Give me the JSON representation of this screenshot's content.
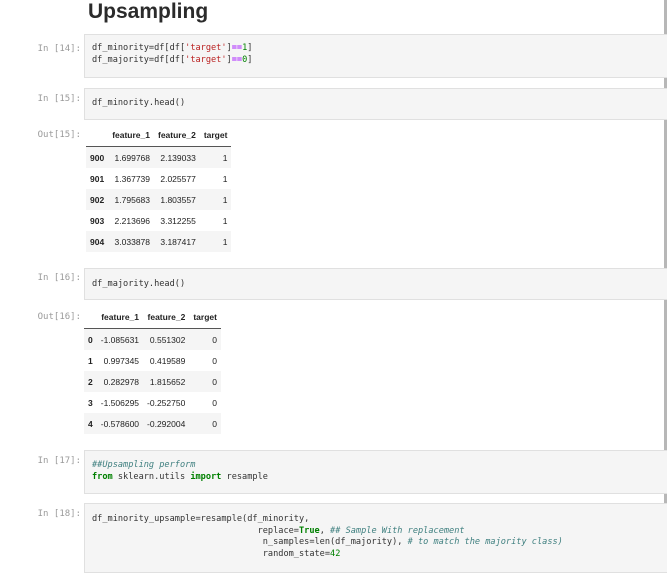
{
  "heading": "Upsampling",
  "cells": {
    "c14": {
      "prompt": "In [14]:",
      "line1": "df_minority=df[df['target']==1]",
      "line2": "df_majority=df[df['target']==0]"
    },
    "c15": {
      "prompt": "In [15]:",
      "code": "df_minority.head()",
      "out_prompt": "Out[15]:"
    },
    "c16": {
      "prompt": "In [16]:",
      "code": "df_majority.head()",
      "out_prompt": "Out[16]:"
    },
    "c17": {
      "prompt": "In [17]:",
      "comment": "##Upsampling perform",
      "from": "from",
      "module": " sklearn.utils ",
      "import": "import",
      "name": " resample"
    },
    "c18": {
      "prompt": "In [18]:",
      "line1": "df_minority_upsample=resample(df_minority,",
      "l2_a": "replace=",
      "l2_true": "True",
      "l2_b": ", ",
      "l2_comment": "## Sample With replacement",
      "l3_a": "n_samples=len(df_majority), ",
      "l3_comment": "# to match the majority class)",
      "l4_a": "random_state=",
      "l4_num": "42"
    }
  },
  "table_minority": {
    "columns": [
      "",
      "feature_1",
      "feature_2",
      "target"
    ],
    "rows": [
      [
        "900",
        "1.699768",
        "2.139033",
        "1"
      ],
      [
        "901",
        "1.367739",
        "2.025577",
        "1"
      ],
      [
        "902",
        "1.795683",
        "1.803557",
        "1"
      ],
      [
        "903",
        "2.213696",
        "3.312255",
        "1"
      ],
      [
        "904",
        "3.033878",
        "3.187417",
        "1"
      ]
    ]
  },
  "table_majority": {
    "columns": [
      "",
      "feature_1",
      "feature_2",
      "target"
    ],
    "rows": [
      [
        "0",
        "-1.085631",
        "0.551302",
        "0"
      ],
      [
        "1",
        "0.997345",
        "0.419589",
        "0"
      ],
      [
        "2",
        "0.282978",
        "1.815652",
        "0"
      ],
      [
        "3",
        "-1.506295",
        "-0.252750",
        "0"
      ],
      [
        "4",
        "-0.578600",
        "-0.292004",
        "0"
      ]
    ]
  }
}
